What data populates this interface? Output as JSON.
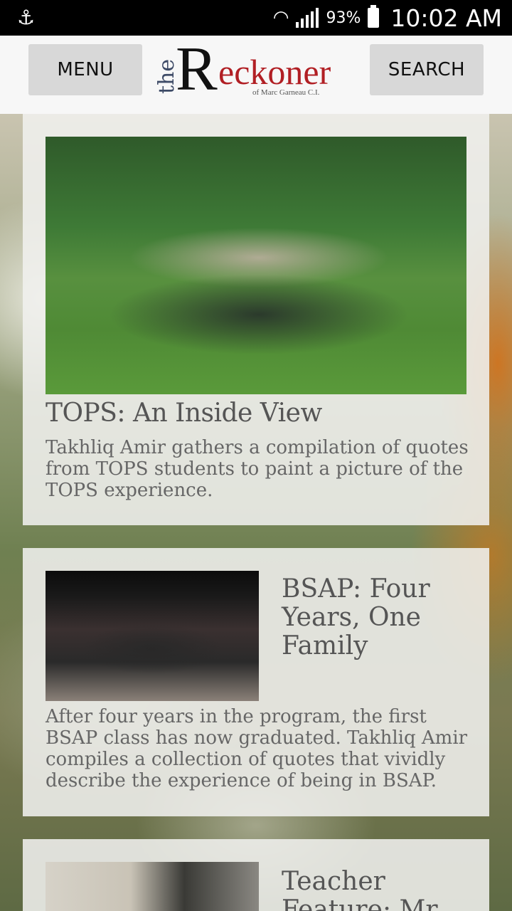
{
  "status_bar": {
    "usb_icon": "usb-icon",
    "battery_percent": "93%",
    "time": "10:02 AM"
  },
  "header": {
    "menu_label": "MENU",
    "search_label": "SEARCH",
    "logo": {
      "the": "the",
      "r": "R",
      "rest": "eckoner",
      "sub": "of Marc Garneau C.I."
    }
  },
  "articles": [
    {
      "title": "TOPS: An Inside View",
      "description": "Takhliq Amir gathers a compilation of quotes from TOPS students to paint a picture of the TOPS experience."
    },
    {
      "title": "BSAP: Four Years, One Family",
      "description": "After four years in the program, the first BSAP class has now graduated. Takhliq Amir compiles a collection of quotes that vividly describe the experience of being in BSAP."
    },
    {
      "title": "Teacher Feature: Mr."
    }
  ],
  "colors": {
    "logo_red": "#b11f24",
    "logo_blue": "#3d4a66",
    "header_bg": "#f7f7f7",
    "button_bg": "#d8d8d8"
  }
}
